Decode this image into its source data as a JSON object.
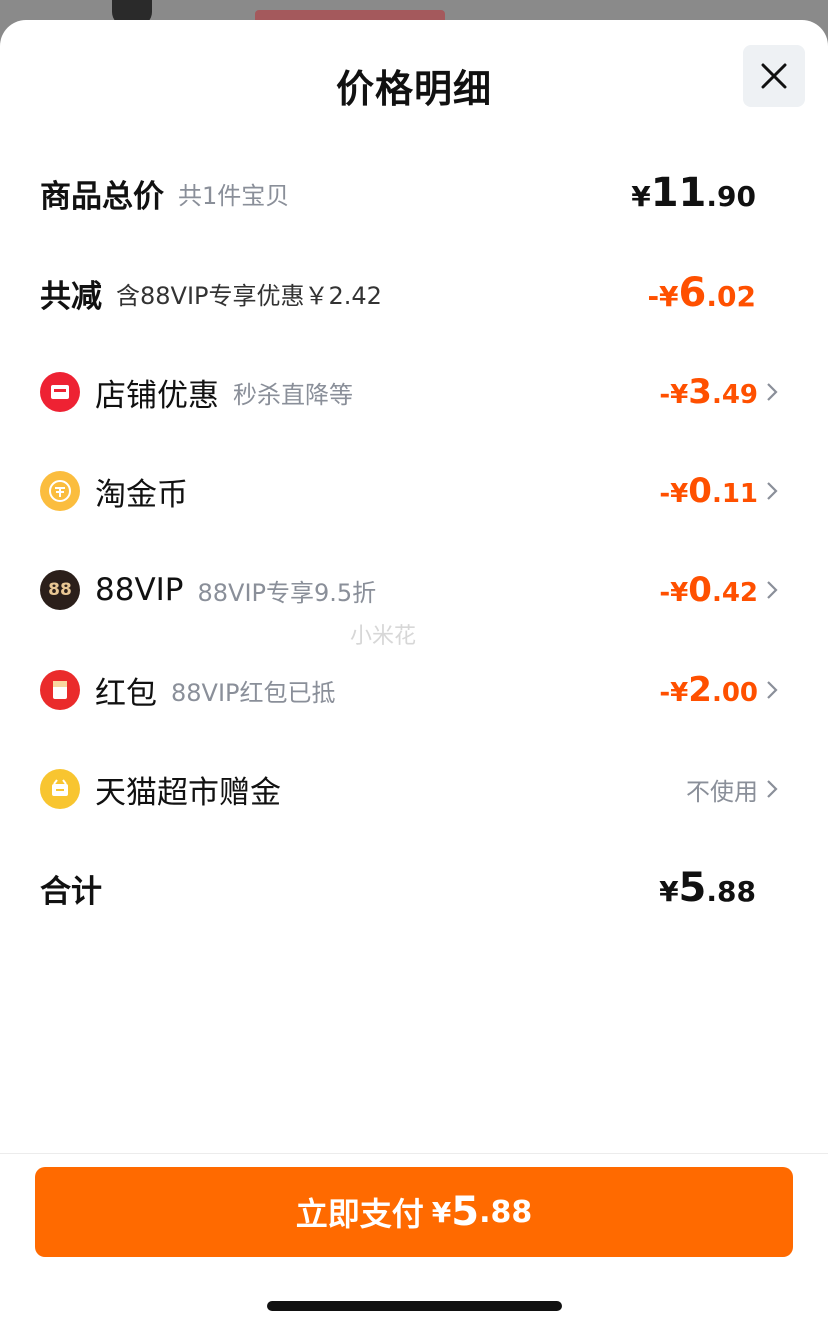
{
  "header": {
    "title": "价格明细"
  },
  "rows": [
    {
      "label": "商品总价",
      "sub": "共1件宝贝",
      "amount": {
        "currency": "¥",
        "int": "11",
        "dec": ".90"
      }
    },
    {
      "label": "共减",
      "sub": "含88VIP专享优惠￥2.42",
      "amount": {
        "currency": "-¥",
        "int": "6",
        "dec": ".02"
      }
    },
    {
      "label": "店铺优惠",
      "sub": "秒杀直降等",
      "amount": {
        "currency": "-¥",
        "int": "3",
        "dec": ".49"
      }
    },
    {
      "label": "淘金币",
      "sub": "",
      "amount": {
        "currency": "-¥",
        "int": "0",
        "dec": ".11"
      }
    },
    {
      "label": "88VIP",
      "sub": "88VIP专享9.5折",
      "icon_text": "88",
      "amount": {
        "currency": "-¥",
        "int": "0",
        "dec": ".42"
      }
    },
    {
      "label": "红包",
      "sub": "88VIP红包已抵",
      "amount": {
        "currency": "-¥",
        "int": "2",
        "dec": ".00"
      }
    },
    {
      "label": "天猫超市赠金",
      "sub": "",
      "status": "不使用"
    },
    {
      "label": "合计",
      "sub": "",
      "amount": {
        "currency": "¥",
        "int": "5",
        "dec": ".88"
      }
    }
  ],
  "watermark": "小米花",
  "pay_button": {
    "label": "立即支付",
    "currency": "¥",
    "int": "5",
    "dec": ".88"
  },
  "icons": [
    "close-icon",
    "shop-icon",
    "coin-icon",
    "vip-icon",
    "red-packet-icon",
    "gift-icon",
    "chevron-right-icon"
  ],
  "colors": {
    "accent": "#ff6a00",
    "discount": "#ff5000",
    "text": "#111111",
    "muted": "#8a8f99"
  }
}
